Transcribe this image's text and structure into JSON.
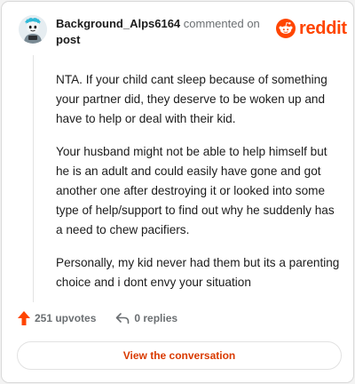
{
  "comment": {
    "username": "Background_Alps6164",
    "action_text": "commented on",
    "target_text": "post",
    "paragraphs": [
      "NTA. If your child cant sleep because of something your partner did, they deserve to be woken up and have to help or deal with their kid.",
      "Your husband might not be able to help himself but he is an adult and could easily have gone and got another one after destroying it or looked into some type of help/support to find out why he suddenly has a need to chew pacifiers.",
      "Personally, my kid never had them but its a parenting choice and i dont envy your situation"
    ]
  },
  "brand": {
    "name": "reddit",
    "color": "#ff4500"
  },
  "stats": {
    "upvotes": "251 upvotes",
    "replies": "0 replies"
  },
  "actions": {
    "view_conversation": "View the conversation"
  },
  "icons": {
    "avatar": "snoo-avatar",
    "logo": "reddit-logo-icon",
    "upvote": "upvote-arrow-icon",
    "reply": "reply-arrow-icon"
  }
}
